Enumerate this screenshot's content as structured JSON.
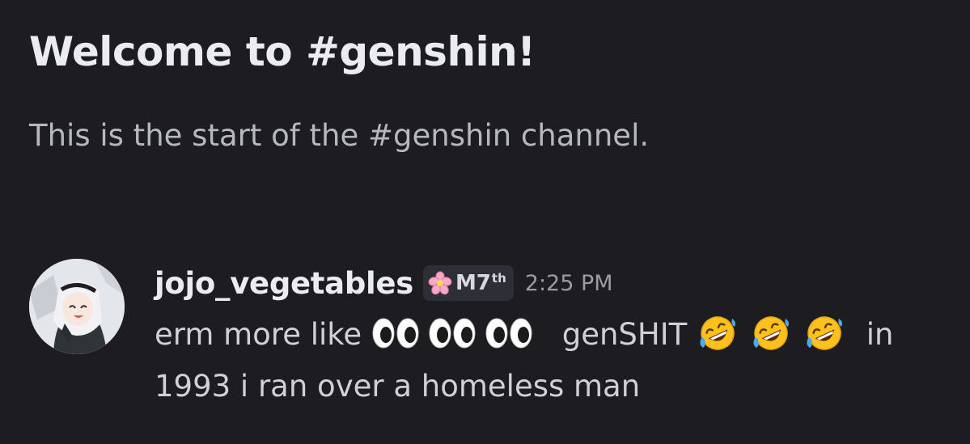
{
  "welcome": {
    "title": "Welcome to #genshin!",
    "subtitle": "This is the start of the #genshin channel."
  },
  "message": {
    "username": "jojo_vegetables",
    "role": {
      "icon": "cherry-blossom-icon",
      "label": "M7",
      "suffix": "th"
    },
    "timestamp": "2:25 PM",
    "text_before": "erm more like",
    "emoji_1": "eyes-emoji",
    "text_middle": "genSHIT",
    "emoji_2": "rolling-on-floor-laughing-emoji",
    "text_after": "in 1993 i ran over a homeless man"
  },
  "colors": {
    "background": "#1c1c21",
    "title": "#ebecef",
    "subtitle": "#b5b8bf",
    "body_text": "#cfd1d6",
    "timestamp": "#9a9ca3",
    "badge_bg": "#2e2f36"
  }
}
